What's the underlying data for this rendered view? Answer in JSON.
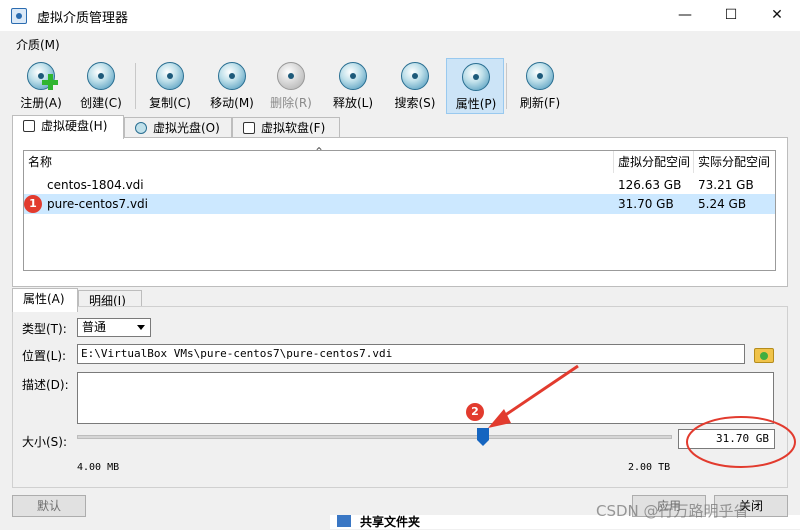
{
  "window": {
    "title": "虚拟介质管理器",
    "min": "—",
    "max": "☐",
    "close": "✕"
  },
  "menu": {
    "media": "介质(M)"
  },
  "toolbar": [
    {
      "key": "register",
      "label": "注册(A)",
      "icon": "register-disk-icon"
    },
    {
      "key": "create",
      "label": "创建(C)",
      "icon": "create-disk-icon"
    },
    {
      "key": "copy",
      "label": "复制(C)",
      "icon": "copy-disk-icon"
    },
    {
      "key": "move",
      "label": "移动(M)",
      "icon": "move-disk-icon"
    },
    {
      "key": "delete",
      "label": "删除(R)",
      "icon": "delete-disk-icon",
      "disabled": true
    },
    {
      "key": "release",
      "label": "释放(L)",
      "icon": "release-disk-icon"
    },
    {
      "key": "search",
      "label": "搜索(S)",
      "icon": "search-disk-icon"
    },
    {
      "key": "properties",
      "label": "属性(P)",
      "icon": "properties-disk-icon",
      "active": true
    },
    {
      "key": "refresh",
      "label": "刷新(F)",
      "icon": "refresh-icon"
    }
  ],
  "tabs": [
    {
      "label": "虚拟硬盘(H)",
      "selected": true
    },
    {
      "label": "虚拟光盘(O)"
    },
    {
      "label": "虚拟软盘(F)"
    }
  ],
  "table": {
    "sort_indicator": "⌃",
    "columns": [
      "名称",
      "虚拟分配空间",
      "实际分配空间"
    ],
    "rows": [
      {
        "name": "centos-1804.vdi",
        "virtual_size": "126.63 GB",
        "actual_size": "73.21 GB"
      },
      {
        "name": "pure-centos7.vdi",
        "virtual_size": "31.70 GB",
        "actual_size": "5.24 GB",
        "selected": true
      }
    ]
  },
  "detail_tabs": [
    {
      "label": "属性(A)",
      "selected": true
    },
    {
      "label": "明细(I)"
    }
  ],
  "attributes": {
    "type_label": "类型(T):",
    "type_value": "普通",
    "location_label": "位置(L):",
    "location_value": "E:\\VirtualBox VMs\\pure-centos7\\pure-centos7.vdi",
    "description_label": "描述(D):",
    "description_value": "",
    "size_label": "大小(S):",
    "size_value": "31.70 GB",
    "size_min": "4.00 MB",
    "size_max": "2.00 TB",
    "slider_fraction": 0.683
  },
  "buttons": {
    "reset": "默认",
    "apply": "应用",
    "close": "关闭"
  },
  "annotations": {
    "marker1": "1",
    "marker2": "2"
  },
  "background_window": {
    "shared_folders": "共享文件夹"
  },
  "watermark": "CSDN @行万路明乎省",
  "colors": {
    "accent": "#1565c0",
    "selection": "#cce8ff",
    "annotation": "#e23b2e"
  }
}
